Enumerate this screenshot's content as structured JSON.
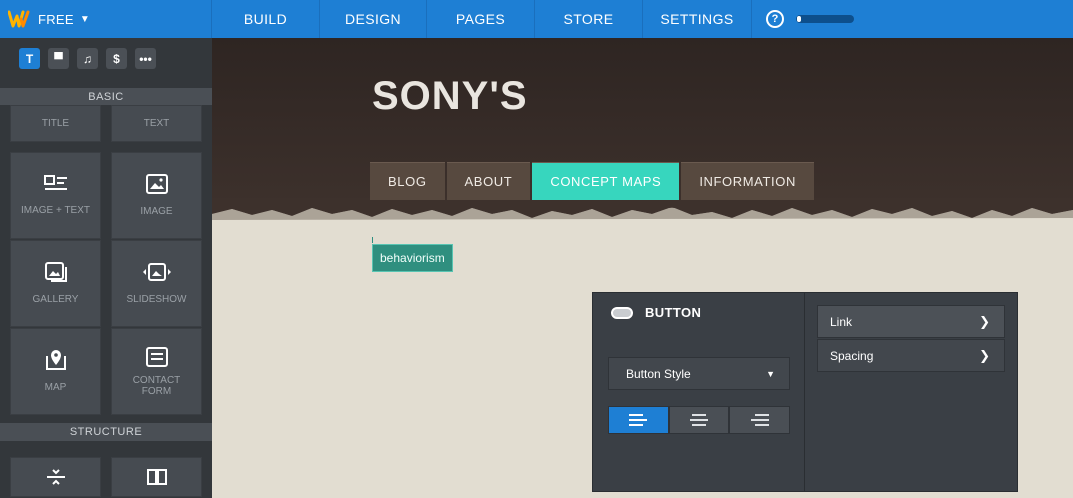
{
  "topbar": {
    "plan_label": "FREE",
    "nav": [
      {
        "label": "BUILD"
      },
      {
        "label": "DESIGN"
      },
      {
        "label": "PAGES"
      },
      {
        "label": "STORE"
      },
      {
        "label": "SETTINGS"
      }
    ],
    "help_glyph": "?",
    "progress_fraction": 0.08,
    "accent_color": "#1e7fd4"
  },
  "sidebar": {
    "tool_tabs": [
      {
        "icon": "text-icon",
        "glyph": "T",
        "active": true
      },
      {
        "icon": "layout-icon",
        "glyph": "▀",
        "active": false
      },
      {
        "icon": "music-icon",
        "glyph": "♫",
        "active": false
      },
      {
        "icon": "dollar-icon",
        "glyph": "$",
        "active": false
      },
      {
        "icon": "more-icon",
        "glyph": "•••",
        "active": false
      }
    ],
    "basic_header": "BASIC",
    "tiles": [
      {
        "label": "TITLE",
        "icon": "title-icon"
      },
      {
        "label": "TEXT",
        "icon": "text-block-icon"
      },
      {
        "label": "IMAGE + TEXT",
        "icon": "image-text-icon"
      },
      {
        "label": "IMAGE",
        "icon": "image-icon"
      },
      {
        "label": "GALLERY",
        "icon": "gallery-icon"
      },
      {
        "label": "SLIDESHOW",
        "icon": "slideshow-icon"
      },
      {
        "label": "MAP",
        "icon": "map-pin-icon"
      },
      {
        "label": "CONTACT FORM",
        "icon": "form-icon"
      }
    ],
    "structure_header": "STRUCTURE",
    "structure_tiles": [
      {
        "icon": "divider-icon"
      },
      {
        "icon": "columns-icon"
      }
    ]
  },
  "site": {
    "title": "SONY'S",
    "nav": [
      {
        "label": "BLOG",
        "active": false
      },
      {
        "label": "ABOUT",
        "active": false
      },
      {
        "label": "CONCEPT MAPS",
        "active": true
      },
      {
        "label": "INFORMATION",
        "active": false
      }
    ],
    "button_label": "behaviorism"
  },
  "panel": {
    "title": "BUTTON",
    "style_select": "Button Style",
    "align_options": [
      {
        "icon": "align-left-icon",
        "active": true
      },
      {
        "icon": "align-center-icon",
        "active": false
      },
      {
        "icon": "align-right-icon",
        "active": false
      }
    ],
    "menu": [
      {
        "label": "Link"
      },
      {
        "label": "Spacing"
      }
    ]
  }
}
